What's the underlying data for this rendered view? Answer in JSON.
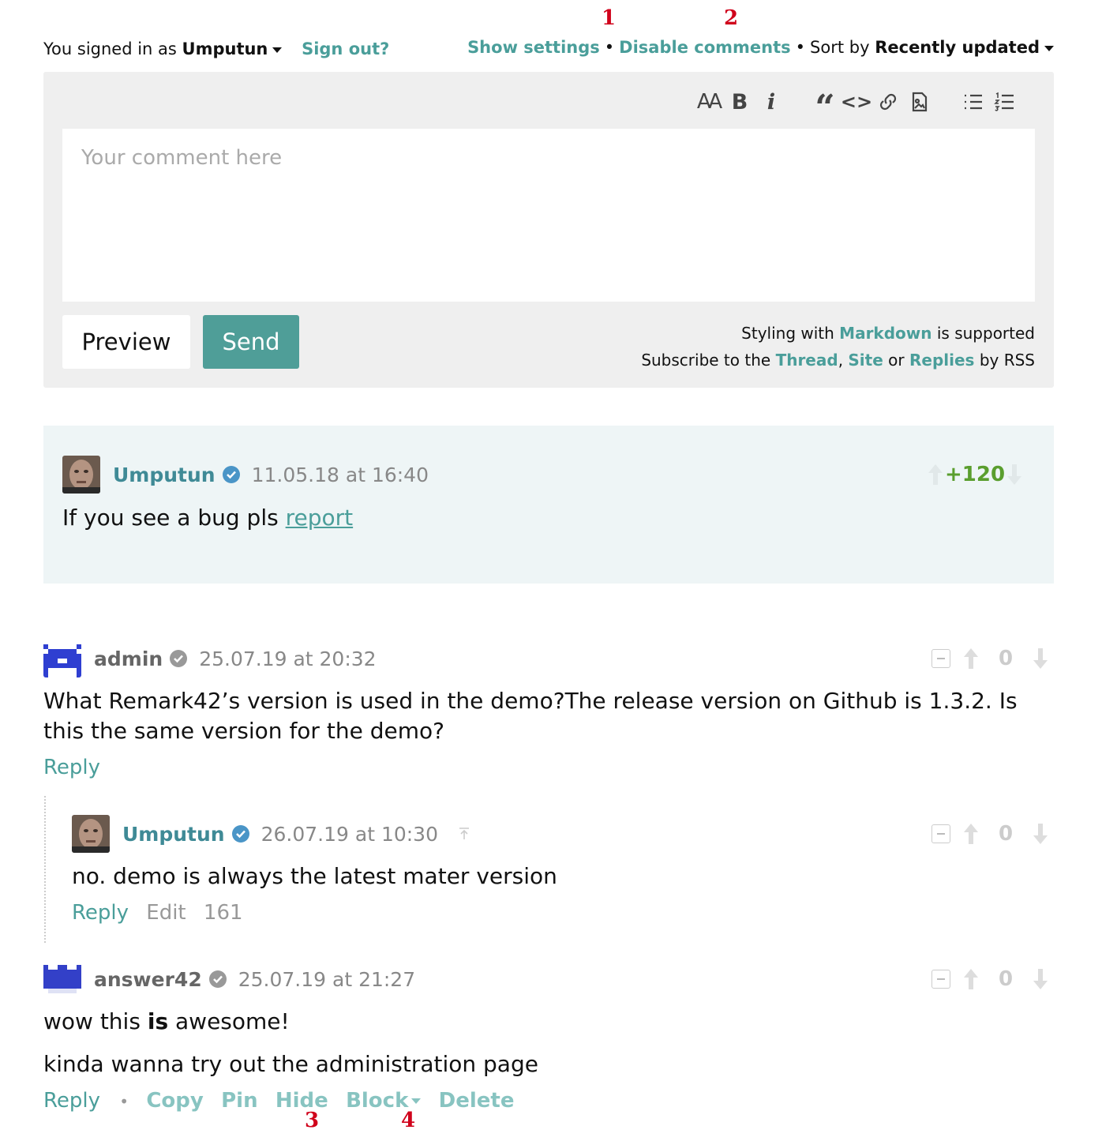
{
  "header": {
    "signed_prefix": "You signed in as",
    "username": "Umputun",
    "sign_out": "Sign out?",
    "show_settings": "Show settings",
    "disable_comments": "Disable comments",
    "sort_prefix": "Sort by",
    "sort_value": "Recently updated",
    "bullet": "•"
  },
  "annotations": {
    "a1": "1",
    "a2": "2",
    "a3": "3",
    "a4": "4"
  },
  "editor": {
    "placeholder": "Your comment here",
    "toolbar": {
      "heading": "AA",
      "bold": "B",
      "italic": "i",
      "quote": "“",
      "code": "<>"
    },
    "preview_label": "Preview",
    "send_label": "Send",
    "styling_prefix": "Styling with",
    "markdown": "Markdown",
    "styling_suffix": "is supported",
    "subscribe_prefix": "Subscribe to the",
    "thread": "Thread",
    "comma": ",",
    "site": "Site",
    "or": "or",
    "replies": "Replies",
    "by_rss": "by RSS"
  },
  "colors": {
    "accent": "#4a9e9a",
    "send_button": "#4f9e98",
    "pinned_bg": "#eef5f6",
    "positive_score": "#5a9e2e",
    "annotation": "#d0021b"
  },
  "comments": {
    "pinned": {
      "author": "Umputun",
      "time": "11.05.18 at 16:40",
      "text_prefix": "If you see a bug pls",
      "link": "report",
      "score": "+120"
    },
    "c1": {
      "author": "admin",
      "time": "25.07.19 at 20:32",
      "text": "What Remark42’s version is used in the demo?The release version on Github is 1.3.2. Is this the same version for the demo?",
      "score": "0",
      "reply": "Reply"
    },
    "c2": {
      "author": "Umputun",
      "time": "26.07.19 at 10:30",
      "text": "no. demo is always the latest mater version",
      "score": "0",
      "reply": "Reply",
      "edit": "Edit",
      "edit_seconds": "161"
    },
    "c3": {
      "author": "answer42",
      "time": "25.07.19 at 21:27",
      "text1_a": "wow this",
      "text1_b": "is",
      "text1_c": "awesome!",
      "text2": "kinda wanna try out the administration page",
      "score": "0",
      "reply": "Reply",
      "copy": "Copy",
      "pin": "Pin",
      "hide": "Hide",
      "block": "Block",
      "delete": "Delete"
    }
  }
}
